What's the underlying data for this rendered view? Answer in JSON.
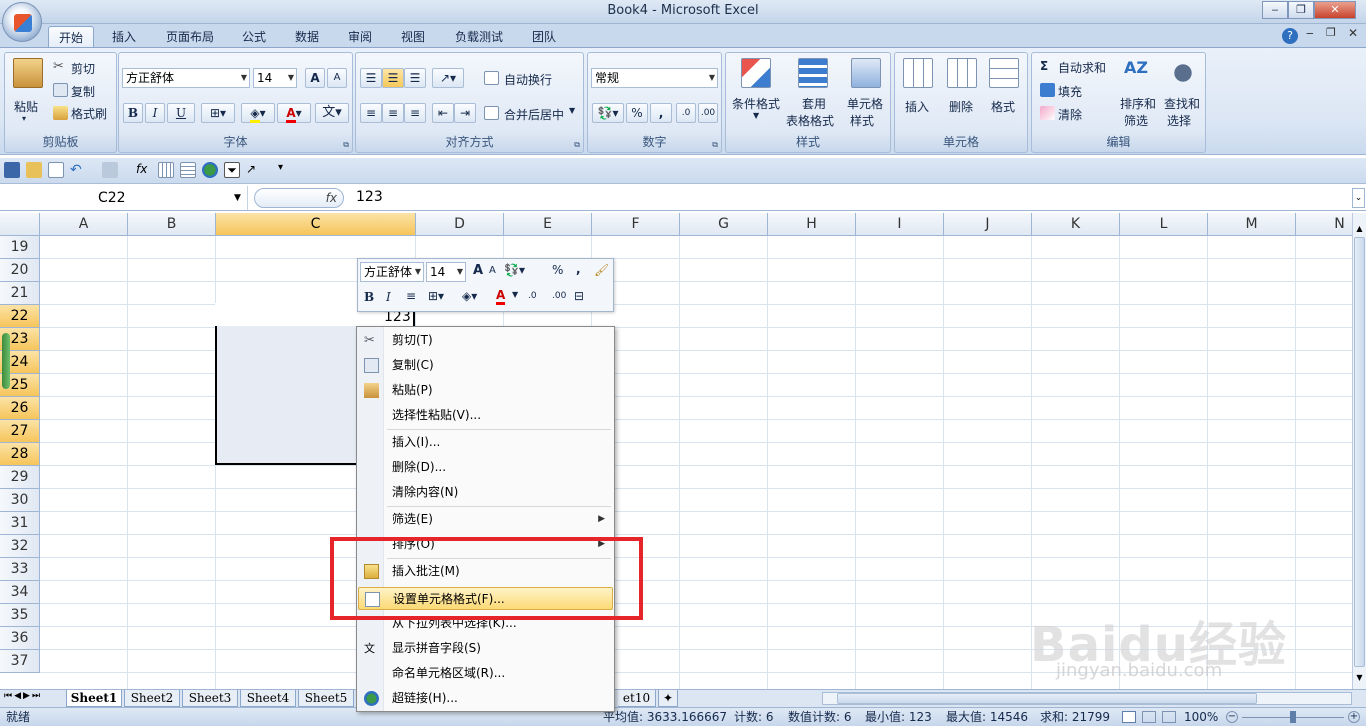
{
  "window": {
    "title": "Book4 - Microsoft Excel"
  },
  "ribbon_tabs": [
    "开始",
    "插入",
    "页面布局",
    "公式",
    "数据",
    "审阅",
    "视图",
    "负载测试",
    "团队"
  ],
  "clipboard": {
    "paste": "粘贴",
    "cut": "剪切",
    "copy": "复制",
    "format_painter": "格式刷",
    "label": "剪贴板"
  },
  "font": {
    "name": "方正舒体",
    "size": "14",
    "grow": "A",
    "shrink": "A",
    "label": "字体",
    "bold": "B",
    "italic": "I",
    "underline": "U",
    "phonetic": "文"
  },
  "alignment": {
    "wrap": "自动换行",
    "merge": "合并后居中",
    "label": "对齐方式"
  },
  "number": {
    "format": "常规",
    "percent": "%",
    "comma": ",",
    "label": "数字"
  },
  "styles": {
    "conditional": "条件格式",
    "table_format_1": "套用",
    "table_format_2": "表格格式",
    "cell_styles_1": "单元格",
    "cell_styles_2": "样式",
    "label": "样式"
  },
  "cells": {
    "insert": "插入",
    "delete": "删除",
    "format": "格式",
    "label": "单元格"
  },
  "editing": {
    "autosum": "自动求和",
    "fill": "填充",
    "clear": "清除",
    "sort_1": "排序和",
    "sort_2": "筛选",
    "find_1": "查找和",
    "find_2": "选择",
    "label": "编辑"
  },
  "formula_bar": {
    "name_box": "C22",
    "fx": "fx",
    "content": "123"
  },
  "columns": [
    "A",
    "B",
    "C",
    "D",
    "E",
    "F",
    "G",
    "H",
    "I",
    "J",
    "K",
    "L",
    "M",
    "N"
  ],
  "rows": [
    "19",
    "20",
    "21",
    "22",
    "23",
    "24",
    "25",
    "26",
    "27",
    "28",
    "29",
    "30",
    "31",
    "32",
    "33",
    "34",
    "35",
    "36",
    "37"
  ],
  "cell_value": "123",
  "mini_toolbar": {
    "font": "方正舒体",
    "size": "14",
    "percent": "%",
    "comma": ","
  },
  "context_menu": [
    {
      "label": "剪切(T)",
      "icon": "scissors-icon"
    },
    {
      "label": "复制(C)",
      "icon": "copy-icon"
    },
    {
      "label": "粘贴(P)",
      "icon": "paste-icon"
    },
    {
      "label": "选择性粘贴(V)...",
      "icon": ""
    },
    {
      "label": "插入(I)...",
      "icon": ""
    },
    {
      "label": "删除(D)...",
      "icon": ""
    },
    {
      "label": "清除内容(N)",
      "icon": ""
    },
    {
      "label": "筛选(E)",
      "icon": "",
      "submenu": true
    },
    {
      "label": "排序(O)",
      "icon": "",
      "submenu": true
    },
    {
      "label": "插入批注(M)",
      "icon": "comment-icon"
    },
    {
      "label": "设置单元格格式(F)...",
      "icon": "format-cells-icon",
      "highlighted": true
    },
    {
      "label": "从下拉列表中选择(K)...",
      "icon": ""
    },
    {
      "label": "显示拼音字段(S)",
      "icon": "phonetic-icon"
    },
    {
      "label": "命名单元格区域(R)...",
      "icon": ""
    },
    {
      "label": "超链接(H)...",
      "icon": "hyperlink-icon"
    }
  ],
  "sheet_tabs": [
    "Sheet1",
    "Sheet2",
    "Sheet3",
    "Sheet4",
    "Sheet5",
    "et10"
  ],
  "status_bar": {
    "ready": "就绪",
    "average": "平均值: 3633.166667",
    "count": "计数: 6",
    "num_count": "数值计数: 6",
    "min": "最小值: 123",
    "max": "最大值: 14546",
    "sum": "求和: 21799",
    "zoom": "100%"
  },
  "watermark": {
    "text": "Baidu经验",
    "url": "jingyan.baidu.com"
  },
  "colors": {
    "accent": "#f6c55b",
    "highlight_box": "#e6252b",
    "ribbon": "#dbe6f4"
  }
}
